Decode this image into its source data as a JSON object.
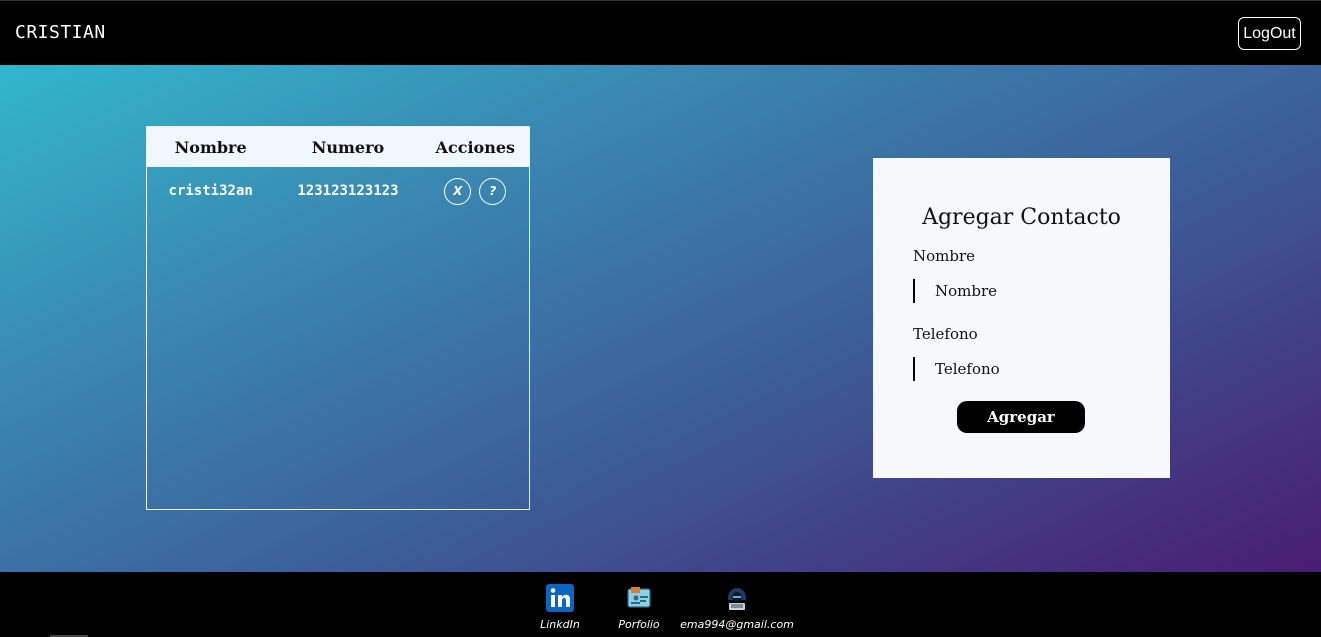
{
  "header": {
    "brand": "CRISTIAN",
    "logout_label": "LogOut"
  },
  "table": {
    "columns": [
      "Nombre",
      "Numero",
      "Acciones"
    ],
    "rows": [
      {
        "nombre": "cristi32an",
        "numero": "123123123123",
        "delete_label": "X",
        "info_label": "?"
      }
    ]
  },
  "form": {
    "title": "Agregar Contacto",
    "name_label": "Nombre",
    "name_placeholder": "Nombre",
    "phone_label": "Telefono",
    "phone_placeholder": "Telefono",
    "submit_label": "Agregar"
  },
  "footer": {
    "links": [
      {
        "label": "LinkdIn",
        "icon": "linkedin-icon"
      },
      {
        "label": "Porfolio",
        "icon": "portfolio-icon"
      },
      {
        "label": "ema994@gmail.com",
        "icon": "hacker-avatar-icon"
      }
    ]
  },
  "colors": {
    "gradient_start": "#32b7cc",
    "gradient_end": "#4a1d72",
    "linkedin_blue": "#0a66c2"
  }
}
